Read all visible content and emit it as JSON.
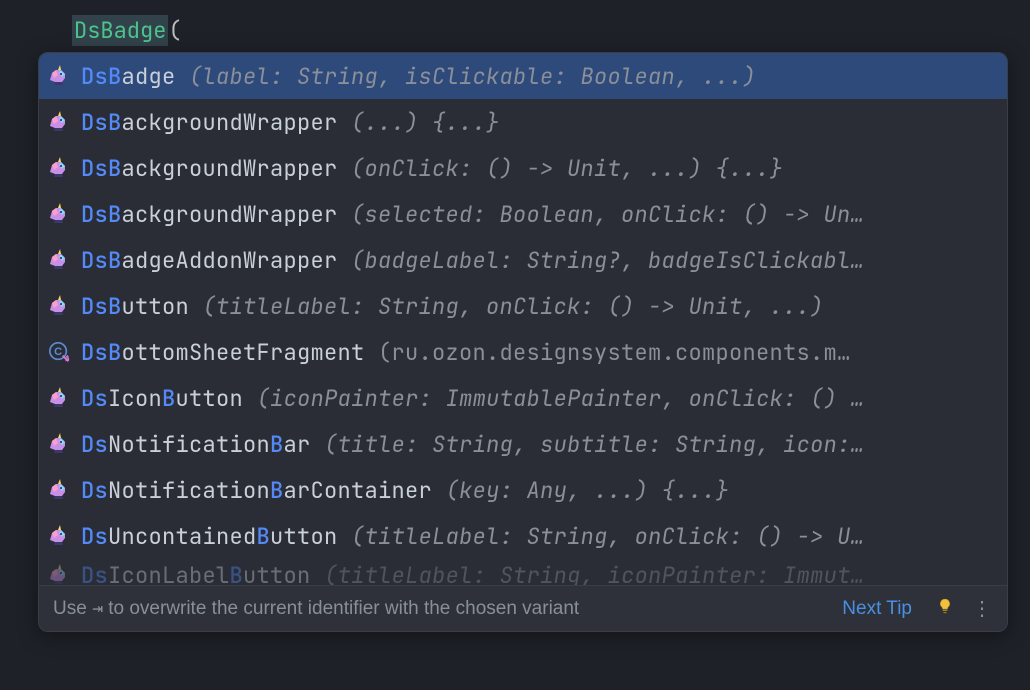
{
  "editor": {
    "typed_prefix": "DsBadge",
    "typed_suffix": "("
  },
  "completions": [
    {
      "icon": "unicorn",
      "tokens": [
        {
          "t": "Ds",
          "c": "hl"
        },
        {
          "t": "B",
          "c": "hl"
        },
        {
          "t": "adge",
          "c": "prefix"
        },
        {
          "t": " (label: String, isClickable: Boolean, ...)",
          "c": "sig"
        }
      ],
      "selected": true
    },
    {
      "icon": "unicorn",
      "tokens": [
        {
          "t": "Ds",
          "c": "hl"
        },
        {
          "t": "B",
          "c": "hl"
        },
        {
          "t": "ackgroundWrapper",
          "c": "prefix"
        },
        {
          "t": " (...) {...}",
          "c": "sig"
        }
      ]
    },
    {
      "icon": "unicorn",
      "tokens": [
        {
          "t": "Ds",
          "c": "hl"
        },
        {
          "t": "B",
          "c": "hl"
        },
        {
          "t": "ackgroundWrapper",
          "c": "prefix"
        },
        {
          "t": " (onClick: () -> Unit, ...) {...}",
          "c": "sig"
        }
      ]
    },
    {
      "icon": "unicorn",
      "tokens": [
        {
          "t": "Ds",
          "c": "hl"
        },
        {
          "t": "B",
          "c": "hl"
        },
        {
          "t": "ackgroundWrapper",
          "c": "prefix"
        },
        {
          "t": " (selected: Boolean, onClick: () -> Un…",
          "c": "sig"
        }
      ]
    },
    {
      "icon": "unicorn",
      "tokens": [
        {
          "t": "Ds",
          "c": "hl"
        },
        {
          "t": "B",
          "c": "hl"
        },
        {
          "t": "adgeAddonWrapper",
          "c": "prefix"
        },
        {
          "t": " (badgeLabel: String?, badgeIsClickabl…",
          "c": "sig"
        }
      ]
    },
    {
      "icon": "unicorn",
      "tokens": [
        {
          "t": "Ds",
          "c": "hl"
        },
        {
          "t": "B",
          "c": "hl"
        },
        {
          "t": "utton",
          "c": "prefix"
        },
        {
          "t": " (titleLabel: String, onClick: () -> Unit, ...)",
          "c": "sig"
        }
      ]
    },
    {
      "icon": "class",
      "tokens": [
        {
          "t": "Ds",
          "c": "hl"
        },
        {
          "t": "B",
          "c": "hl"
        },
        {
          "t": "ottomSheetFragment",
          "c": "prefix"
        },
        {
          "t": "  (ru.ozon.designsystem.components.m…",
          "c": "pkg"
        }
      ]
    },
    {
      "icon": "unicorn",
      "tokens": [
        {
          "t": "Ds",
          "c": "hl"
        },
        {
          "t": "Icon",
          "c": "prefix"
        },
        {
          "t": "B",
          "c": "hl"
        },
        {
          "t": "utton",
          "c": "prefix"
        },
        {
          "t": " (iconPainter: ImmutablePainter, onClick: () …",
          "c": "sig"
        }
      ]
    },
    {
      "icon": "unicorn",
      "tokens": [
        {
          "t": "Ds",
          "c": "hl"
        },
        {
          "t": "Notification",
          "c": "prefix"
        },
        {
          "t": "B",
          "c": "hl"
        },
        {
          "t": "ar",
          "c": "prefix"
        },
        {
          "t": " (title: String, subtitle: String, icon:…",
          "c": "sig"
        }
      ]
    },
    {
      "icon": "unicorn",
      "tokens": [
        {
          "t": "Ds",
          "c": "hl"
        },
        {
          "t": "Notification",
          "c": "prefix"
        },
        {
          "t": "B",
          "c": "hl"
        },
        {
          "t": "arContainer",
          "c": "prefix"
        },
        {
          "t": " (key: Any, ...) {...}",
          "c": "sig"
        }
      ]
    },
    {
      "icon": "unicorn",
      "tokens": [
        {
          "t": "Ds",
          "c": "hl"
        },
        {
          "t": "Uncontained",
          "c": "prefix"
        },
        {
          "t": "B",
          "c": "hl"
        },
        {
          "t": "utton",
          "c": "prefix"
        },
        {
          "t": " (titleLabel: String, onClick: () -> U…",
          "c": "sig"
        }
      ]
    },
    {
      "icon": "unicorn",
      "partial": true,
      "tokens": [
        {
          "t": "Ds",
          "c": "hl"
        },
        {
          "t": "IconLabel",
          "c": "prefix"
        },
        {
          "t": "B",
          "c": "hl"
        },
        {
          "t": "utton",
          "c": "prefix"
        },
        {
          "t": " (titleLabel: String, iconPainter: Immut…",
          "c": "sig"
        }
      ]
    }
  ],
  "footer": {
    "tip_prefix": "Use ",
    "tip_key": "⇥",
    "tip_suffix": " to overwrite the current identifier with the chosen variant",
    "next_tip": "Next Tip"
  }
}
